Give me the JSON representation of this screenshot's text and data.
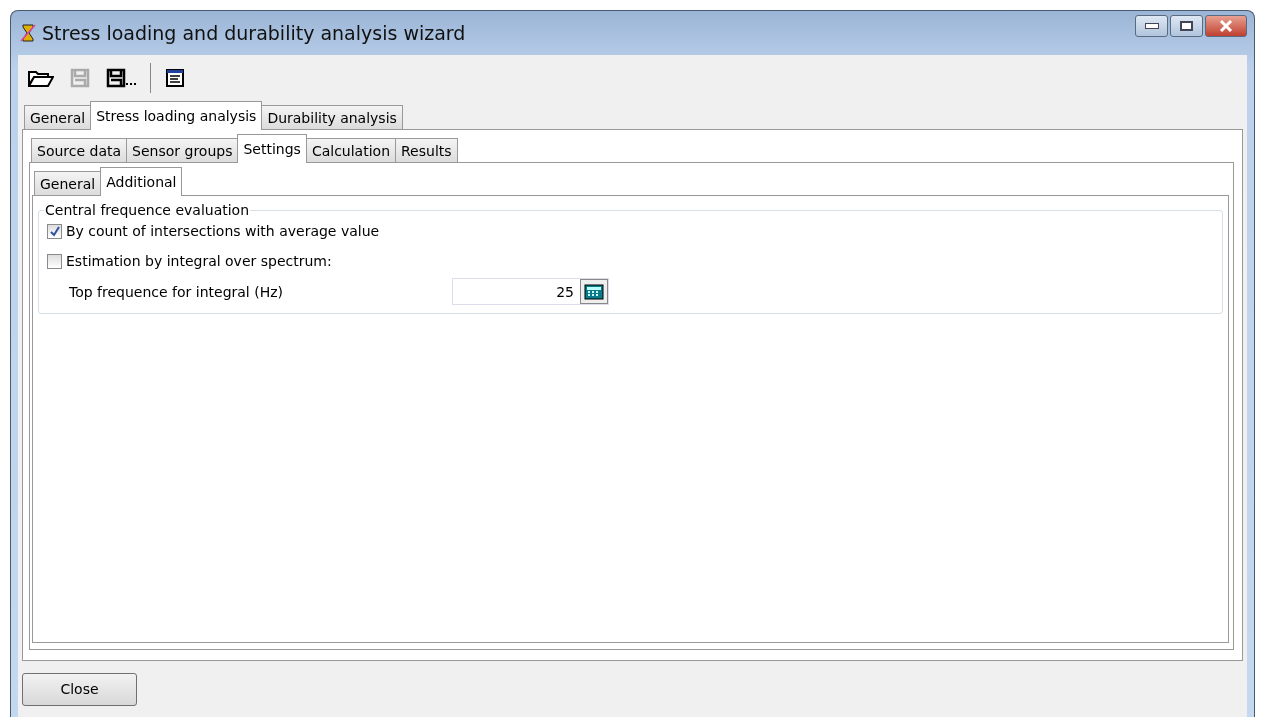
{
  "window": {
    "title": "Stress loading and durability analysis wizard"
  },
  "toolbar": [
    {
      "kind": "open"
    },
    {
      "kind": "save",
      "disabled": true
    },
    {
      "kind": "save_as"
    },
    {
      "kind": "separator"
    },
    {
      "kind": "report"
    }
  ],
  "main_tabs": [
    {
      "label": "General",
      "selected": false
    },
    {
      "label": "Stress loading analysis",
      "selected": true
    },
    {
      "label": "Durability analysis",
      "selected": false
    }
  ],
  "stress_tabs": [
    {
      "label": "Source data",
      "selected": false
    },
    {
      "label": "Sensor groups",
      "selected": false
    },
    {
      "label": "Settings",
      "selected": true
    },
    {
      "label": "Calculation",
      "selected": false
    },
    {
      "label": "Results",
      "selected": false
    }
  ],
  "settings_tabs": [
    {
      "label": "General",
      "selected": false
    },
    {
      "label": "Additional",
      "selected": true
    }
  ],
  "group": {
    "title": "Central frequence evaluation",
    "options": [
      {
        "label": "By count of intersections with average value",
        "checked": true
      },
      {
        "label": "Estimation by integral over spectrum:",
        "checked": false
      }
    ],
    "field": {
      "label": "Top frequence for integral (Hz)",
      "value": "25"
    }
  },
  "buttons": [
    {
      "label": "Close"
    }
  ]
}
